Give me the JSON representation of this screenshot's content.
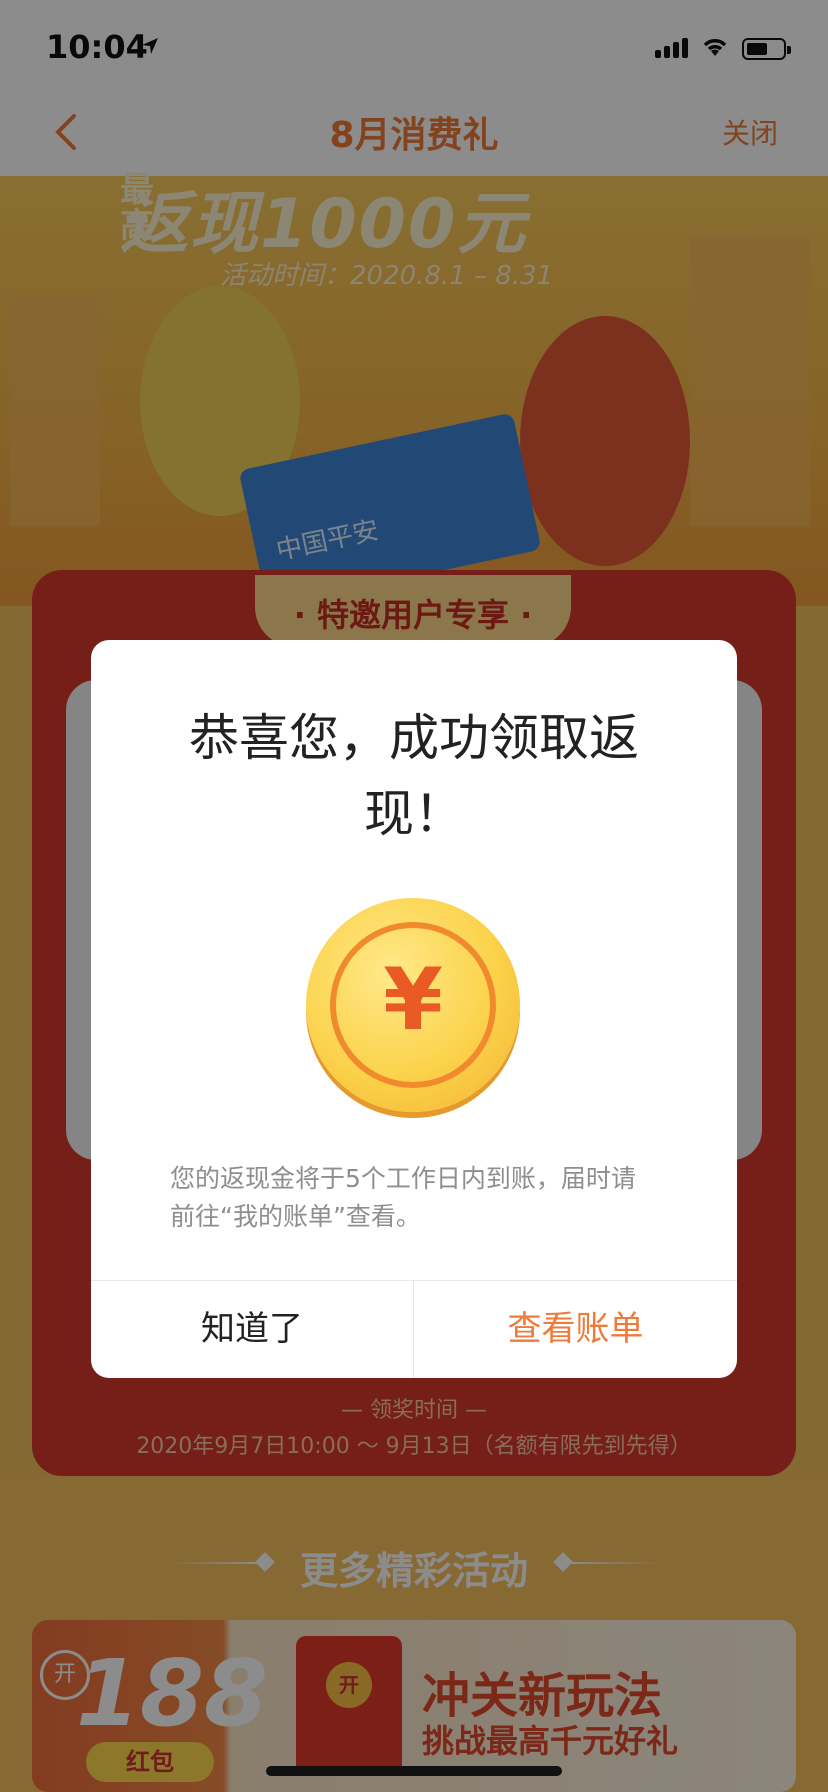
{
  "status_bar": {
    "time": "10:04"
  },
  "nav": {
    "title": "8月消费礼",
    "close_label": "关闭"
  },
  "hero": {
    "headline": "返现1000元",
    "headline_prefix": "最高",
    "activity_time": "活动时间：2020.8.1 – 8.31",
    "card_text": "中国平安"
  },
  "panel": {
    "tag": "· 特邀用户专享 ·",
    "claim_title": "— 领奖时间 —",
    "claim_time": "2020年9月7日10:00 ～ 9月13日（名额有限先到先得）"
  },
  "modal": {
    "title": "恭喜您，成功领取返现！",
    "coin_symbol": "¥",
    "desc": "您的返现金将于5个工作日内到账，届时请前往“我的账单”查看。",
    "btn_ok": "知道了",
    "btn_view": "查看账单"
  },
  "more": {
    "title": "更多精彩活动",
    "banner": {
      "open_badge": "开",
      "amount": "188",
      "pill": "红包",
      "envelope_seal": "开",
      "line1": "冲关新玩法",
      "line2": "挑战最高千元好礼"
    }
  },
  "colors": {
    "accent": "#ef7a3a",
    "panel_red": "#d53a2d"
  }
}
